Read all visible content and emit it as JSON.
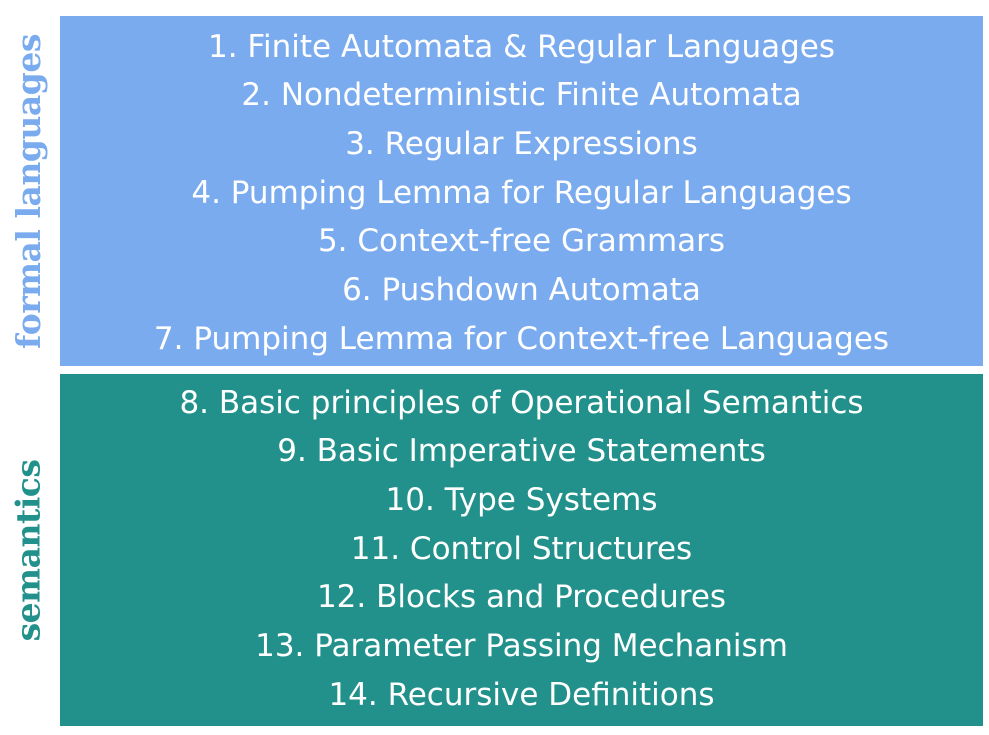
{
  "colors": {
    "formal_bg": "#7aabee",
    "formal_label": "#7aabee",
    "semantics_bg": "#23918b",
    "semantics_label": "#23918b",
    "topic_text": "#ffffff"
  },
  "sections": [
    {
      "label": "formal languages",
      "topics": [
        "1. Finite Automata & Regular Languages",
        "2. Nondeterministic Finite Automata",
        "3. Regular Expressions",
        "4. Pumping Lemma for Regular Languages",
        "5. Context-free Grammars",
        "6. Pushdown Automata",
        "7. Pumping Lemma for Context-free Languages"
      ]
    },
    {
      "label": "semantics",
      "topics": [
        "8. Basic principles of Operational Semantics",
        "9. Basic Imperative Statements",
        "10. Type Systems",
        "11. Control Structures",
        "12. Blocks and Procedures",
        "13. Parameter Passing Mechanism",
        "14. Recursive Definitions"
      ]
    }
  ]
}
